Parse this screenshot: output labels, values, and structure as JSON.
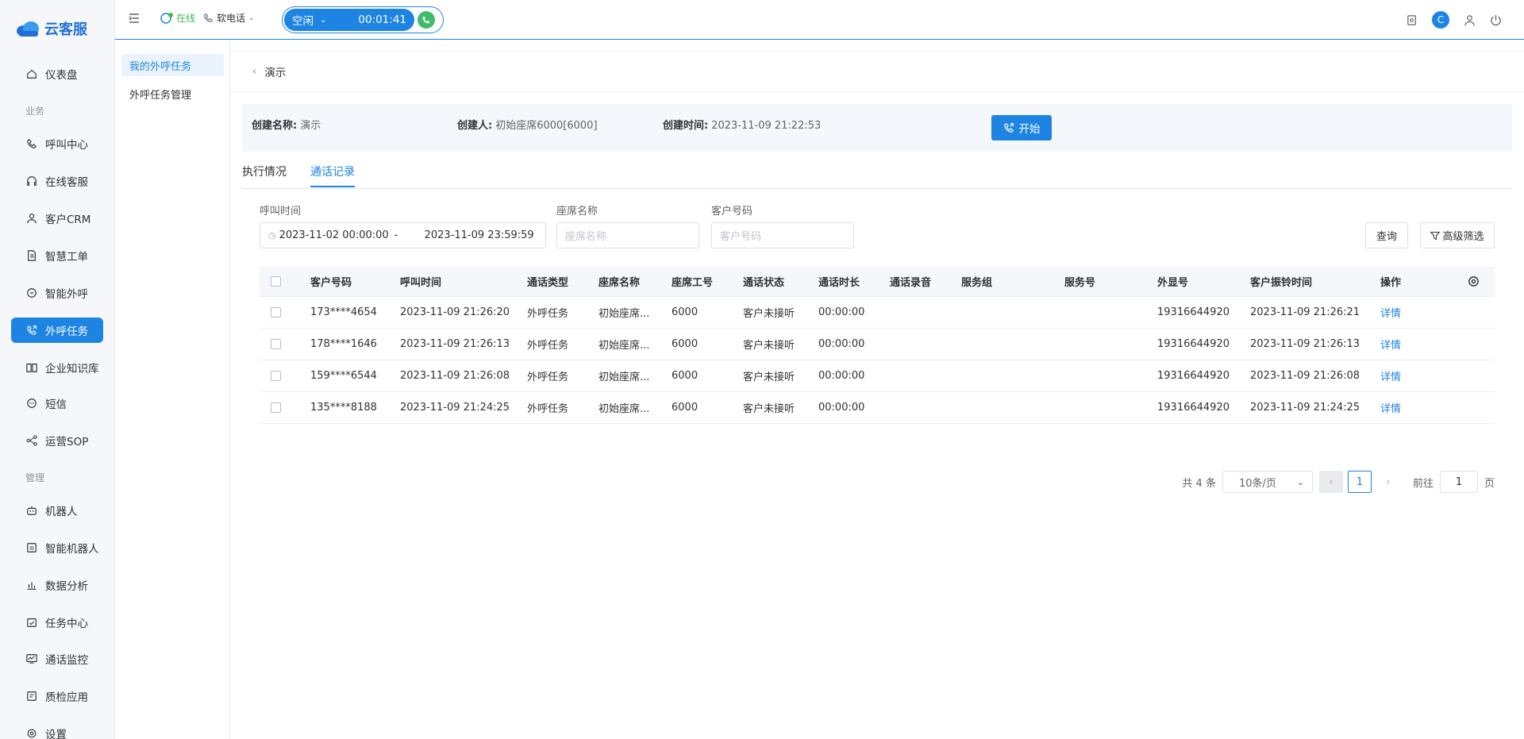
{
  "brand": {
    "name": "云客服"
  },
  "sidebar": {
    "items": [
      {
        "label": "仪表盘",
        "icon": "home-icon"
      },
      {
        "group": "业务"
      },
      {
        "label": "呼叫中心",
        "icon": "phone-icon"
      },
      {
        "label": "在线客服",
        "icon": "headset-icon"
      },
      {
        "label": "客户CRM",
        "icon": "user-icon"
      },
      {
        "label": "智慧工单",
        "icon": "document-icon"
      },
      {
        "label": "智能外呼",
        "icon": "chat-icon"
      },
      {
        "label": "外呼任务",
        "icon": "outbound-call-icon",
        "active": true
      },
      {
        "label": "企业知识库",
        "icon": "book-icon"
      },
      {
        "label": "短信",
        "icon": "sms-icon"
      },
      {
        "label": "运营SOP",
        "icon": "flow-icon"
      },
      {
        "group": "管理"
      },
      {
        "label": "机器人",
        "icon": "robot-icon"
      },
      {
        "label": "智能机器人",
        "icon": "smart-robot-icon"
      },
      {
        "label": "数据分析",
        "icon": "bar-chart-icon"
      },
      {
        "label": "任务中心",
        "icon": "task-icon"
      },
      {
        "label": "通话监控",
        "icon": "monitor-icon"
      },
      {
        "label": "质检应用",
        "icon": "quality-icon"
      },
      {
        "label": "设置",
        "icon": "gear-icon"
      }
    ]
  },
  "topbar": {
    "status": "在线",
    "softphone": "软电话",
    "call_state": "空闲",
    "call_timer": "00:01:41",
    "avatar_letter": "C"
  },
  "submenu": {
    "items": [
      "我的外呼任务",
      "外呼任务管理"
    ]
  },
  "page": {
    "back_title": "演示",
    "info": {
      "name_label": "创建名称:",
      "name_value": "演示",
      "creator_label": "创建人:",
      "creator_value": "初始座席6000[6000]",
      "time_label": "创建时间:",
      "time_value": "2023-11-09 21:22:53"
    },
    "start_button": "开始",
    "tabs": [
      "执行情况",
      "通话记录"
    ],
    "active_tab": 1
  },
  "filters": {
    "call_time_label": "呼叫时间",
    "date_start": "2023-11-02 00:00:00",
    "date_sep": "-",
    "date_end": "2023-11-09 23:59:59",
    "agent_label": "座席名称",
    "agent_placeholder": "座席名称",
    "customer_label": "客户号码",
    "customer_placeholder": "客户号码",
    "query_button": "查询",
    "advanced_button": "高级筛选"
  },
  "table": {
    "columns": [
      "客户号码",
      "呼叫时间",
      "通话类型",
      "座席名称",
      "座席工号",
      "通话状态",
      "通话时长",
      "通话录音",
      "服务组",
      "服务号",
      "外显号",
      "客户振铃时间",
      "操作"
    ],
    "rows": [
      {
        "customer": "173****4654",
        "call_time": "2023-11-09 21:26:20",
        "type": "外呼任务",
        "agent": "初始座席...",
        "agent_no": "6000",
        "status": "客户未接听",
        "duration": "00:00:00",
        "display_no": "19316644920",
        "ring_time": "2023-11-09 21:26:21",
        "action": "详情"
      },
      {
        "customer": "178****1646",
        "call_time": "2023-11-09 21:26:13",
        "type": "外呼任务",
        "agent": "初始座席...",
        "agent_no": "6000",
        "status": "客户未接听",
        "duration": "00:00:00",
        "display_no": "19316644920",
        "ring_time": "2023-11-09 21:26:13",
        "action": "详情"
      },
      {
        "customer": "159****6544",
        "call_time": "2023-11-09 21:26:08",
        "type": "外呼任务",
        "agent": "初始座席...",
        "agent_no": "6000",
        "status": "客户未接听",
        "duration": "00:00:00",
        "display_no": "19316644920",
        "ring_time": "2023-11-09 21:26:08",
        "action": "详情"
      },
      {
        "customer": "135****8188",
        "call_time": "2023-11-09 21:24:25",
        "type": "外呼任务",
        "agent": "初始座席...",
        "agent_no": "6000",
        "status": "客户未接听",
        "duration": "00:00:00",
        "display_no": "19316644920",
        "ring_time": "2023-11-09 21:24:25",
        "action": "详情"
      }
    ]
  },
  "pagination": {
    "total": "共 4 条",
    "page_size": "10条/页",
    "current_page": "1",
    "goto_label": "前往",
    "goto_value": "1",
    "page_suffix": "页"
  },
  "colors": {
    "accent": "#1d84e3",
    "online": "#3fb950",
    "call_green": "#3dbd6a"
  }
}
